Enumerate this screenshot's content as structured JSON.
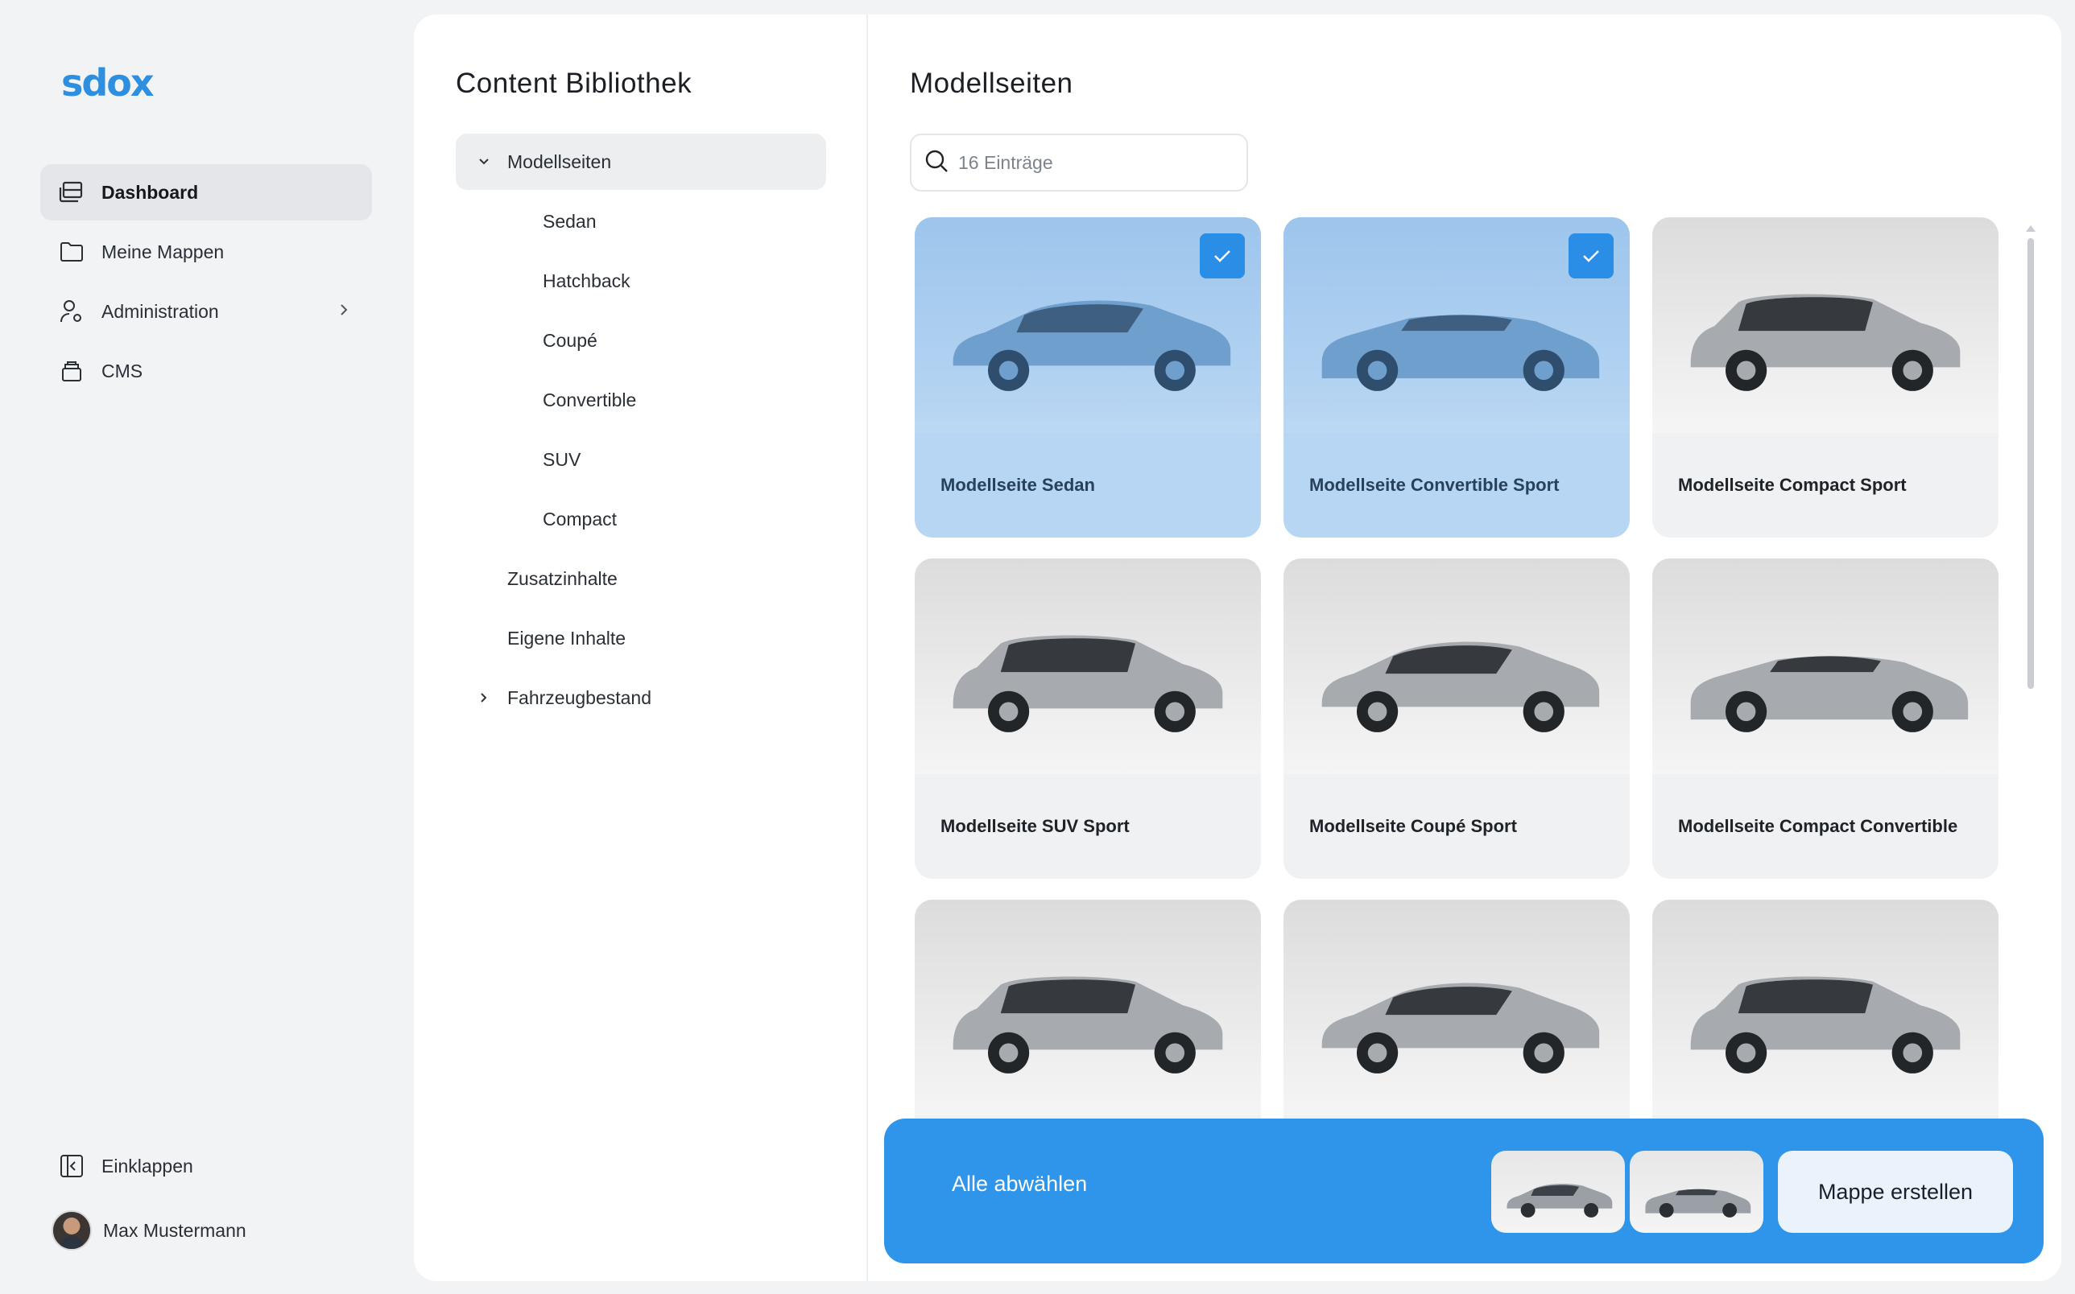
{
  "brand": {
    "logo_text": "sdox",
    "accent": "#2e8fe0"
  },
  "sidebar": {
    "items": [
      {
        "label": "Dashboard",
        "icon": "folders-icon",
        "active": true
      },
      {
        "label": "Meine Mappen",
        "icon": "folder-icon"
      },
      {
        "label": "Administration",
        "icon": "user-settings-icon",
        "has_submenu": true
      },
      {
        "label": "CMS",
        "icon": "archive-icon"
      }
    ],
    "collapse_label": "Einklappen",
    "user_name": "Max Mustermann"
  },
  "library": {
    "title": "Content Bibliothek",
    "tree": [
      {
        "label": "Modellseiten",
        "expanded": true
      },
      {
        "label": "Sedan"
      },
      {
        "label": "Hatchback"
      },
      {
        "label": "Coupé"
      },
      {
        "label": "Convertible"
      },
      {
        "label": "SUV"
      },
      {
        "label": "Compact"
      },
      {
        "label": "Zusatzinhalte"
      },
      {
        "label": "Eigene Inhalte"
      },
      {
        "label": "Fahrzeugbestand",
        "expanded": false
      }
    ]
  },
  "grid": {
    "title": "Modellseiten",
    "search_placeholder": "16 Einträge",
    "cards": [
      {
        "label": "Modellseite Sedan",
        "selected": true
      },
      {
        "label": "Modellseite Convertible Sport",
        "selected": true
      },
      {
        "label": "Modellseite Compact Sport",
        "selected": false
      },
      {
        "label": "Modellseite SUV Sport",
        "selected": false
      },
      {
        "label": "Modellseite Coupé Sport",
        "selected": false
      },
      {
        "label": "Modellseite Compact Convertible",
        "selected": false
      },
      {
        "label": "",
        "selected": false
      },
      {
        "label": "",
        "selected": false
      },
      {
        "label": "",
        "selected": false
      }
    ]
  },
  "actionbar": {
    "deselect_label": "Alle abwählen",
    "create_label": "Mappe erstellen",
    "color": "#2e95ea"
  }
}
